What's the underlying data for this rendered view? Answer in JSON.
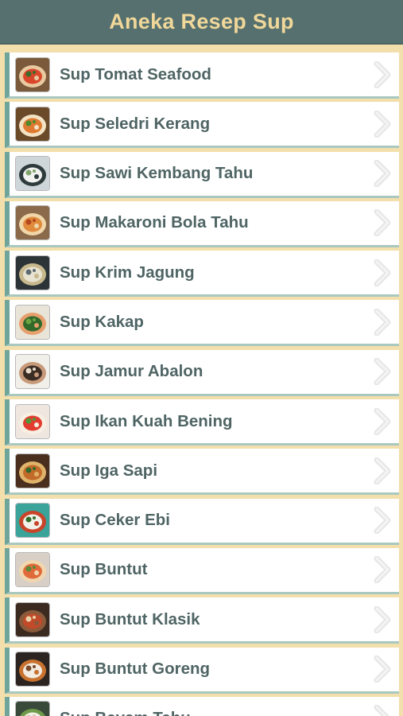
{
  "header": {
    "title": "Aneka Resep Sup"
  },
  "items": [
    {
      "label": "Sup Tomat Seafood",
      "thumb": {
        "bg": "#7a5a3a",
        "a": "#d9472b",
        "b": "#e8c9a0",
        "c": "#3c6b2a"
      }
    },
    {
      "label": "Sup Seledri Kerang",
      "thumb": {
        "bg": "#6b4a2a",
        "a": "#e07a30",
        "b": "#f3e3c4",
        "c": "#4c8a2e"
      }
    },
    {
      "label": "Sup Sawi Kembang Tahu",
      "thumb": {
        "bg": "#cfd6d9",
        "a": "#f2f2f0",
        "b": "#2e3b3d",
        "c": "#7fa36a"
      }
    },
    {
      "label": "Sup Makaroni Bola Tahu",
      "thumb": {
        "bg": "#8a6a4a",
        "a": "#e08a3c",
        "b": "#f0d6a8",
        "c": "#b5471f"
      }
    },
    {
      "label": "Sup Krim Jagung",
      "thumb": {
        "bg": "#2c3438",
        "a": "#e9e4d2",
        "b": "#c7b88d",
        "c": "#5d6b72"
      }
    },
    {
      "label": "Sup Kakap",
      "thumb": {
        "bg": "#e8e4d8",
        "a": "#2f6a2a",
        "b": "#e79f6c",
        "c": "#6ea343"
      }
    },
    {
      "label": "Sup Jamur Abalon",
      "thumb": {
        "bg": "#f1efe9",
        "a": "#3b2c24",
        "b": "#c79a7a",
        "c": "#e9dccb"
      }
    },
    {
      "label": "Sup Ikan Kuah Bening",
      "thumb": {
        "bg": "#f0e6e0",
        "a": "#e23b2f",
        "b": "#f7f0e2",
        "c": "#4d9a3a"
      }
    },
    {
      "label": "Sup Iga Sapi",
      "thumb": {
        "bg": "#4a2e1e",
        "a": "#c26a2a",
        "b": "#e0b36a",
        "c": "#2f6a2a"
      }
    },
    {
      "label": "Sup Ceker Ebi",
      "thumb": {
        "bg": "#3aa39a",
        "a": "#f2f2ea",
        "b": "#c8452a",
        "c": "#2f6e2a"
      }
    },
    {
      "label": "Sup Buntut",
      "thumb": {
        "bg": "#d8cfc6",
        "a": "#e06a3a",
        "b": "#f1d7b0",
        "c": "#5a8a3a"
      }
    },
    {
      "label": "Sup Buntut Klasik",
      "thumb": {
        "bg": "#3a2a20",
        "a": "#c24a2a",
        "b": "#8a5a3a",
        "c": "#e9d3a8"
      }
    },
    {
      "label": "Sup Buntut Goreng",
      "thumb": {
        "bg": "#2b2420",
        "a": "#f2ece2",
        "b": "#c8722f",
        "c": "#7a4a2a"
      }
    },
    {
      "label": "Sup Bayam Tahu",
      "thumb": {
        "bg": "#3a4a3a",
        "a": "#f2f0e8",
        "b": "#6f9a4a",
        "c": "#d9c9a8"
      }
    }
  ]
}
